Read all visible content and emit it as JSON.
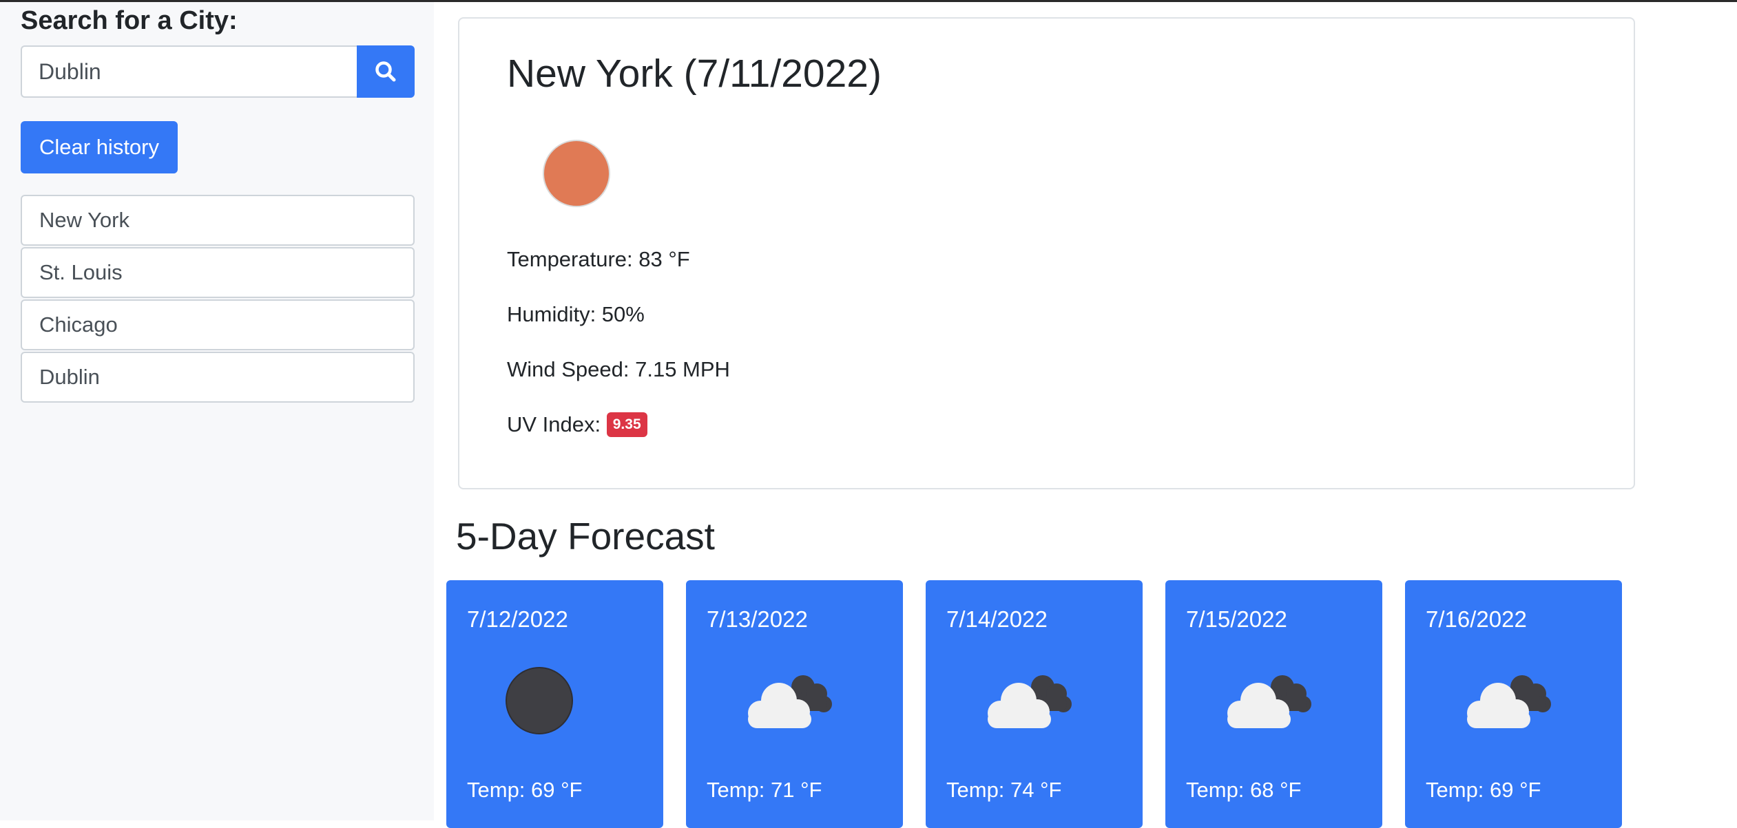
{
  "search": {
    "label": "Search for a City:",
    "value": "Dublin",
    "placeholder": ""
  },
  "buttons": {
    "clear_history": "Clear history"
  },
  "history": [
    "New York",
    "St. Louis",
    "Chicago",
    "Dublin"
  ],
  "current": {
    "title": "New York (7/11/2022)",
    "icon": "clear-day-sun-icon",
    "temperature": "Temperature: 83 °F",
    "humidity": "Humidity: 50%",
    "wind": "Wind Speed: 7.15 MPH",
    "uv_label": "UV Index:",
    "uv_value": "9.35"
  },
  "forecast": {
    "title": "5-Day Forecast",
    "days": [
      {
        "date": "7/12/2022",
        "icon": "clear-night-icon",
        "temp": "Temp: 69 °F"
      },
      {
        "date": "7/13/2022",
        "icon": "broken-clouds-icon",
        "temp": "Temp: 71 °F"
      },
      {
        "date": "7/14/2022",
        "icon": "broken-clouds-icon",
        "temp": "Temp: 74 °F"
      },
      {
        "date": "7/15/2022",
        "icon": "broken-clouds-icon",
        "temp": "Temp: 68 °F"
      },
      {
        "date": "7/16/2022",
        "icon": "broken-clouds-icon",
        "temp": "Temp: 69 °F"
      }
    ]
  },
  "colors": {
    "primary": "#3478f6",
    "uv_badge": "#dc3545",
    "sun": "#e07a55",
    "night_moon": "#3f3f44",
    "sidebar_bg": "#f7f8fa"
  }
}
